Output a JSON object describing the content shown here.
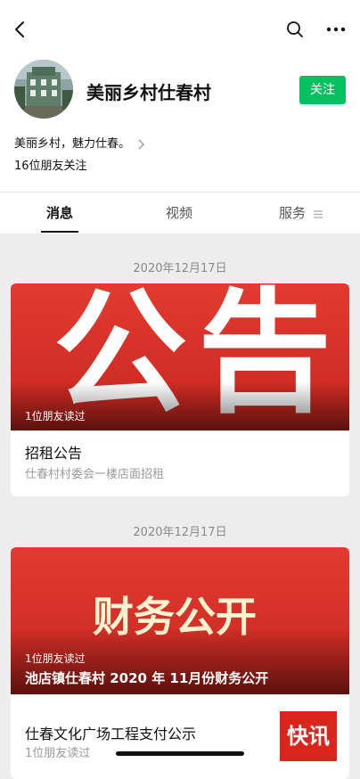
{
  "header": {
    "account_name": "美丽乡村仕春村",
    "follow_label": "关注",
    "bio": "美丽乡村，魅力仕春。",
    "friends_following": "16位朋友关注"
  },
  "tabs": [
    {
      "label": "消息",
      "active": true
    },
    {
      "label": "视频",
      "active": false
    },
    {
      "label": "服务",
      "active": false
    }
  ],
  "feed": [
    {
      "date": "2020年12月17日",
      "banner_text": [
        "公",
        "告"
      ],
      "readers": "1位朋友读过",
      "title": "招租公告",
      "subtitle": "仕春村村委会一楼店面招租"
    },
    {
      "date": "2020年12月17日",
      "banner_text": "财务公开",
      "readers": "1位朋友读过",
      "banner_title": "池店镇仕春村 2020 年 11月份财务公开",
      "title": "仕春文化广场工程支付公示",
      "subtitle": "1位朋友读过",
      "thumb_text": "快讯"
    }
  ],
  "colors": {
    "accent": "#07c160",
    "banner_red": "#d9261c",
    "background": "#ededed"
  },
  "icons": [
    "back-icon",
    "search-icon",
    "more-icon",
    "chevron-right-icon",
    "menu-lines-icon"
  ]
}
